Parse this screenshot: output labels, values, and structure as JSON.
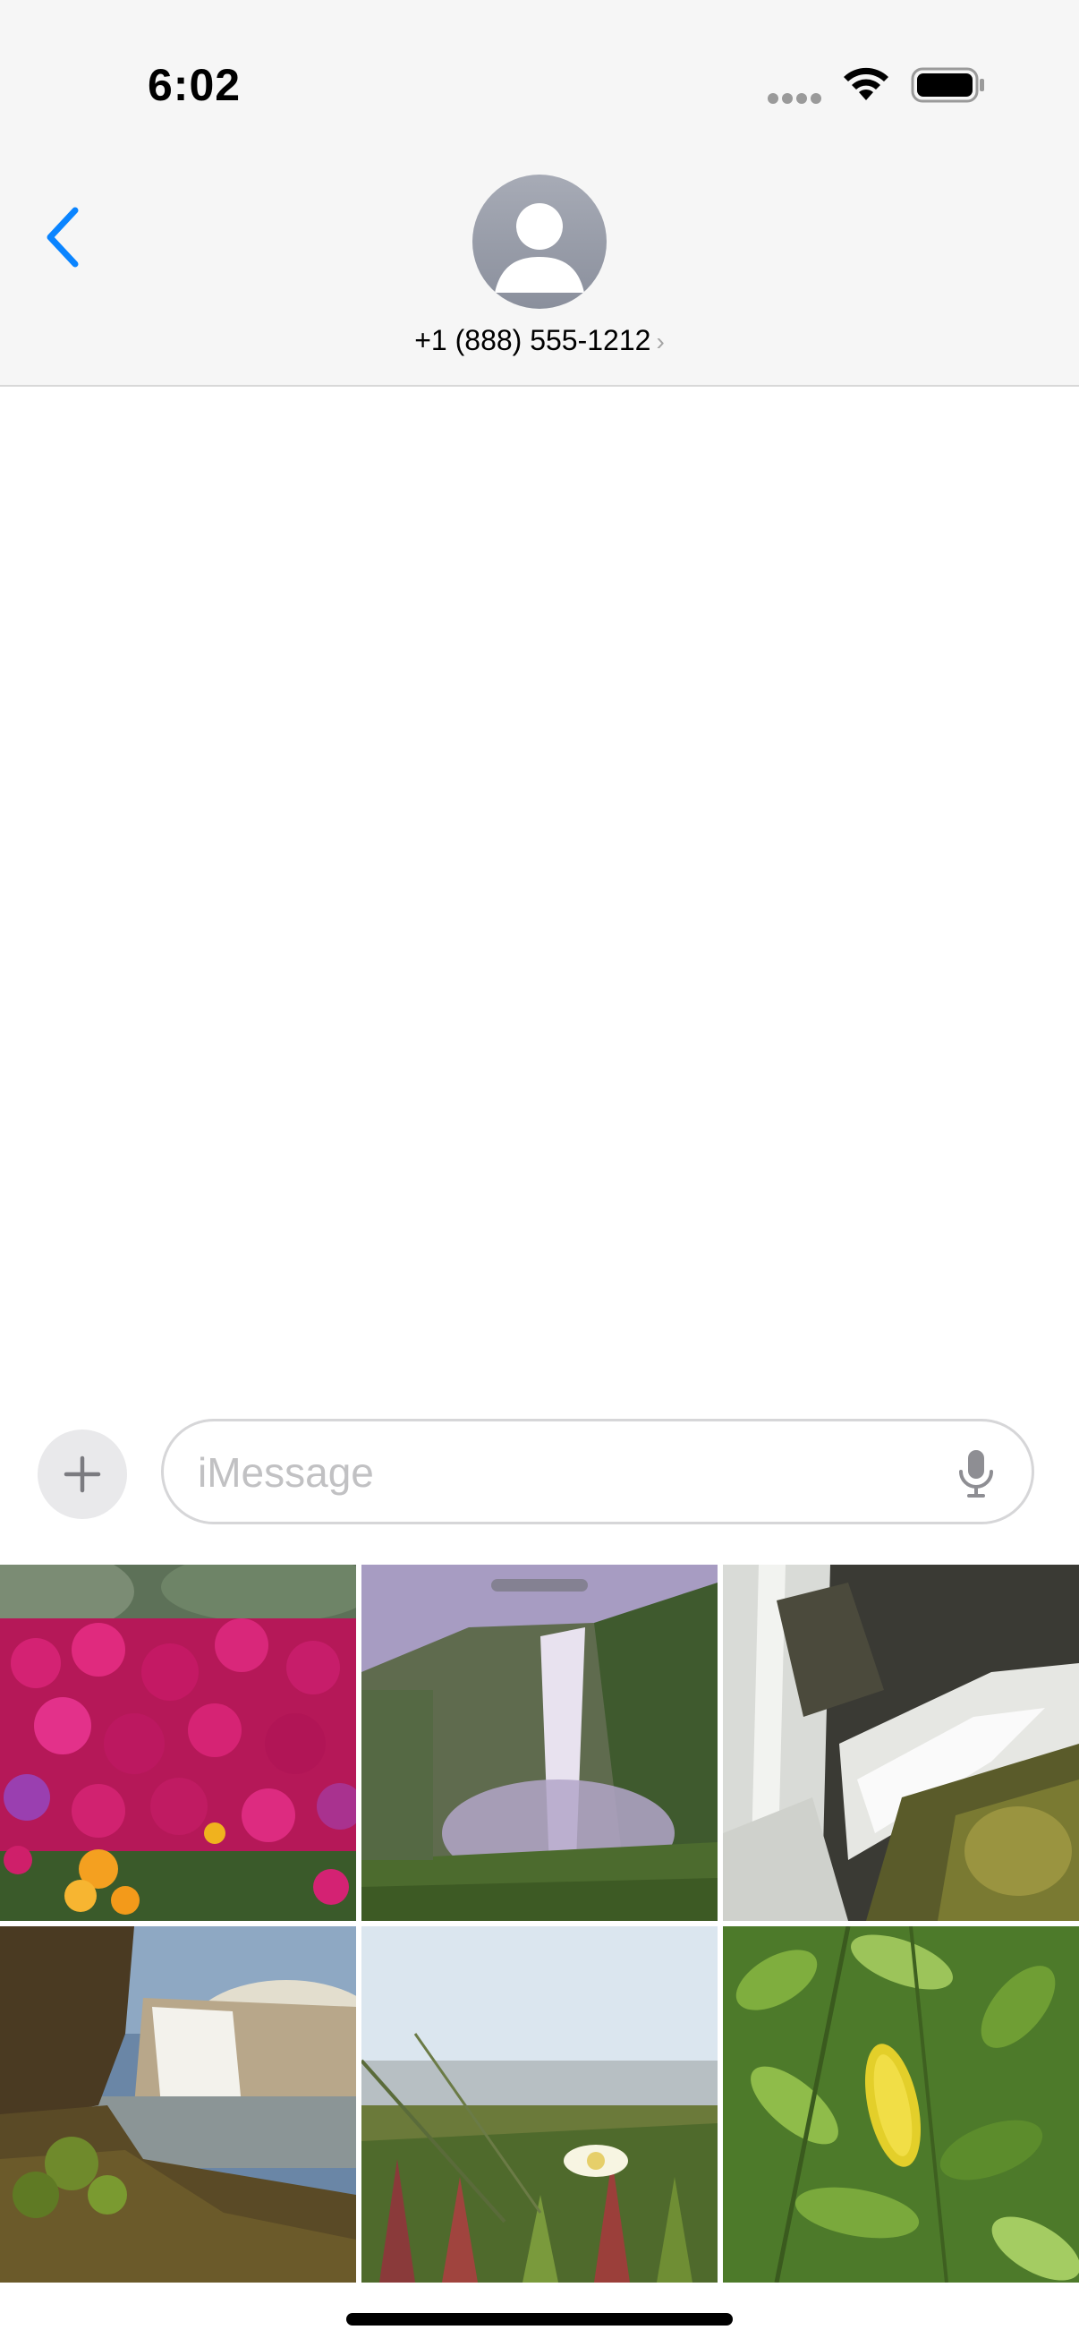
{
  "status_bar": {
    "time": "6:02",
    "icons": [
      "cellular-signal-icon",
      "wifi-icon",
      "battery-icon"
    ]
  },
  "header": {
    "back_icon": "chevron-left-icon",
    "avatar_icon": "person-silhouette-icon",
    "contact_number": "+1 (888) 555-1212",
    "contact_chevron": "›"
  },
  "composer": {
    "plus_icon": "plus-icon",
    "placeholder": "iMessage",
    "value": "",
    "mic_icon": "microphone-icon"
  },
  "photo_picker": {
    "photos": [
      {
        "subject": "pink-and-orange-flowers"
      },
      {
        "subject": "waterfall-in-green-valley"
      },
      {
        "subject": "waterfall-over-mossy-rocks"
      },
      {
        "subject": "waterfall-at-sunset-cliffs"
      },
      {
        "subject": "white-flower-in-grass"
      },
      {
        "subject": "green-leaves-with-yellow-leaf"
      }
    ]
  },
  "colors": {
    "accent": "#0a84ff",
    "header_bg": "#f6f6f6",
    "avatar": "#9da1ac"
  }
}
